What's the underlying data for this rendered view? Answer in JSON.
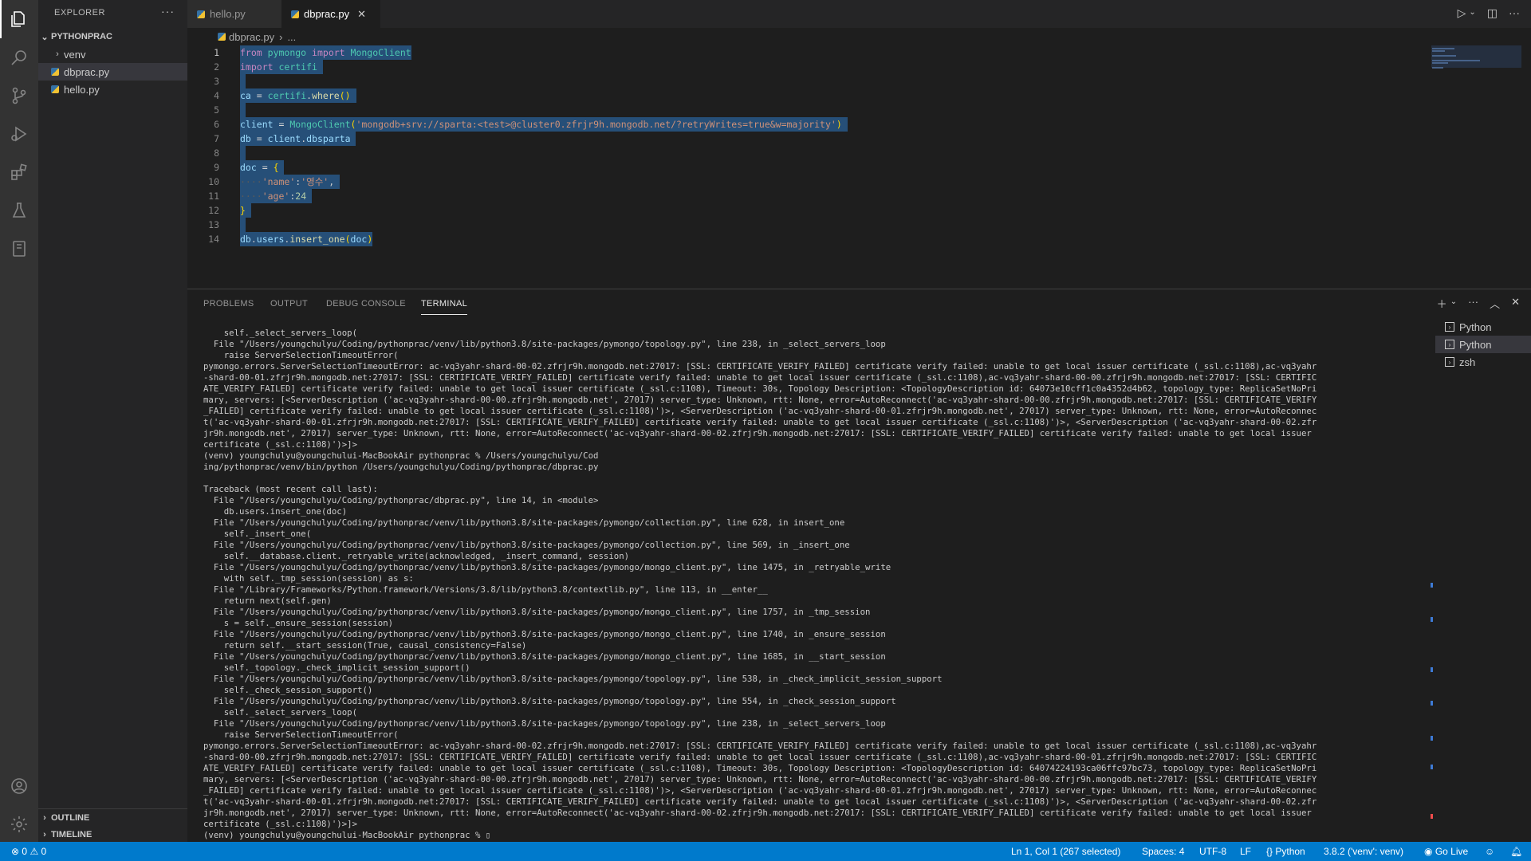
{
  "sidebar": {
    "title": "EXPLORER",
    "more": "···",
    "folder": "PYTHONPRAC",
    "items": [
      {
        "label": "venv",
        "type": "folder"
      },
      {
        "label": "dbprac.py",
        "type": "file",
        "selected": true
      },
      {
        "label": "hello.py",
        "type": "file"
      }
    ],
    "outline": "OUTLINE",
    "timeline": "TIMELINE"
  },
  "tabs": [
    {
      "label": "hello.py",
      "active": false
    },
    {
      "label": "dbprac.py",
      "active": true
    }
  ],
  "breadcrumb": {
    "file": "dbprac.py",
    "rest": "..."
  },
  "editor": {
    "line_numbers": [
      "1",
      "2",
      "3",
      "4",
      "5",
      "6",
      "7",
      "8",
      "9",
      "10",
      "11",
      "12",
      "13",
      "14"
    ]
  },
  "panel": {
    "tabs": [
      "PROBLEMS",
      "OUTPUT",
      "DEBUG CONSOLE",
      "TERMINAL"
    ],
    "active_tab": "TERMINAL",
    "terminal_list": [
      "Python",
      "Python",
      "zsh"
    ],
    "terminal_lines": [
      "    self._select_servers_loop(",
      "  File \"/Users/youngchulyu/Coding/pythonprac/venv/lib/python3.8/site-packages/pymongo/topology.py\", line 238, in _select_servers_loop",
      "    raise ServerSelectionTimeoutError(",
      "pymongo.errors.ServerSelectionTimeoutError: ac-vq3yahr-shard-00-02.zfrjr9h.mongodb.net:27017: [SSL: CERTIFICATE_VERIFY_FAILED] certificate verify failed: unable to get local issuer certificate (_ssl.c:1108),ac-vq3yahr",
      "-shard-00-01.zfrjr9h.mongodb.net:27017: [SSL: CERTIFICATE_VERIFY_FAILED] certificate verify failed: unable to get local issuer certificate (_ssl.c:1108),ac-vq3yahr-shard-00-00.zfrjr9h.mongodb.net:27017: [SSL: CERTIFIC",
      "ATE_VERIFY_FAILED] certificate verify failed: unable to get local issuer certificate (_ssl.c:1108), Timeout: 30s, Topology Description: <TopologyDescription id: 64073e10cff1c0a4352d4b62, topology_type: ReplicaSetNoPri",
      "mary, servers: [<ServerDescription ('ac-vq3yahr-shard-00-00.zfrjr9h.mongodb.net', 27017) server_type: Unknown, rtt: None, error=AutoReconnect('ac-vq3yahr-shard-00-00.zfrjr9h.mongodb.net:27017: [SSL: CERTIFICATE_VERIFY",
      "_FAILED] certificate verify failed: unable to get local issuer certificate (_ssl.c:1108)')>, <ServerDescription ('ac-vq3yahr-shard-00-01.zfrjr9h.mongodb.net', 27017) server_type: Unknown, rtt: None, error=AutoReconnec",
      "t('ac-vq3yahr-shard-00-01.zfrjr9h.mongodb.net:27017: [SSL: CERTIFICATE_VERIFY_FAILED] certificate verify failed: unable to get local issuer certificate (_ssl.c:1108)')>, <ServerDescription ('ac-vq3yahr-shard-00-02.zfr",
      "jr9h.mongodb.net', 27017) server_type: Unknown, rtt: None, error=AutoReconnect('ac-vq3yahr-shard-00-02.zfrjr9h.mongodb.net:27017: [SSL: CERTIFICATE_VERIFY_FAILED] certificate verify failed: unable to get local issuer",
      "certificate (_ssl.c:1108)')>]>",
      "(venv) youngchulyu@youngchului-MacBookAir pythonprac % /Users/youngchulyu/Cod",
      "ing/pythonprac/venv/bin/python /Users/youngchulyu/Coding/pythonprac/dbprac.py",
      "",
      "Traceback (most recent call last):",
      "  File \"/Users/youngchulyu/Coding/pythonprac/dbprac.py\", line 14, in <module>",
      "    db.users.insert_one(doc)",
      "  File \"/Users/youngchulyu/Coding/pythonprac/venv/lib/python3.8/site-packages/pymongo/collection.py\", line 628, in insert_one",
      "    self._insert_one(",
      "  File \"/Users/youngchulyu/Coding/pythonprac/venv/lib/python3.8/site-packages/pymongo/collection.py\", line 569, in _insert_one",
      "    self.__database.client._retryable_write(acknowledged, _insert_command, session)",
      "  File \"/Users/youngchulyu/Coding/pythonprac/venv/lib/python3.8/site-packages/pymongo/mongo_client.py\", line 1475, in _retryable_write",
      "    with self._tmp_session(session) as s:",
      "  File \"/Library/Frameworks/Python.framework/Versions/3.8/lib/python3.8/contextlib.py\", line 113, in __enter__",
      "    return next(self.gen)",
      "  File \"/Users/youngchulyu/Coding/pythonprac/venv/lib/python3.8/site-packages/pymongo/mongo_client.py\", line 1757, in _tmp_session",
      "    s = self._ensure_session(session)",
      "  File \"/Users/youngchulyu/Coding/pythonprac/venv/lib/python3.8/site-packages/pymongo/mongo_client.py\", line 1740, in _ensure_session",
      "    return self.__start_session(True, causal_consistency=False)",
      "  File \"/Users/youngchulyu/Coding/pythonprac/venv/lib/python3.8/site-packages/pymongo/mongo_client.py\", line 1685, in __start_session",
      "    self._topology._check_implicit_session_support()",
      "  File \"/Users/youngchulyu/Coding/pythonprac/venv/lib/python3.8/site-packages/pymongo/topology.py\", line 538, in _check_implicit_session_support",
      "    self._check_session_support()",
      "  File \"/Users/youngchulyu/Coding/pythonprac/venv/lib/python3.8/site-packages/pymongo/topology.py\", line 554, in _check_session_support",
      "    self._select_servers_loop(",
      "  File \"/Users/youngchulyu/Coding/pythonprac/venv/lib/python3.8/site-packages/pymongo/topology.py\", line 238, in _select_servers_loop",
      "    raise ServerSelectionTimeoutError(",
      "pymongo.errors.ServerSelectionTimeoutError: ac-vq3yahr-shard-00-02.zfrjr9h.mongodb.net:27017: [SSL: CERTIFICATE_VERIFY_FAILED] certificate verify failed: unable to get local issuer certificate (_ssl.c:1108),ac-vq3yahr",
      "-shard-00-00.zfrjr9h.mongodb.net:27017: [SSL: CERTIFICATE_VERIFY_FAILED] certificate verify failed: unable to get local issuer certificate (_ssl.c:1108),ac-vq3yahr-shard-00-01.zfrjr9h.mongodb.net:27017: [SSL: CERTIFIC",
      "ATE_VERIFY_FAILED] certificate verify failed: unable to get local issuer certificate (_ssl.c:1108), Timeout: 30s, Topology Description: <TopologyDescription id: 64074224193ca06ffc97bc73, topology_type: ReplicaSetNoPri",
      "mary, servers: [<ServerDescription ('ac-vq3yahr-shard-00-00.zfrjr9h.mongodb.net', 27017) server_type: Unknown, rtt: None, error=AutoReconnect('ac-vq3yahr-shard-00-00.zfrjr9h.mongodb.net:27017: [SSL: CERTIFICATE_VERIFY",
      "_FAILED] certificate verify failed: unable to get local issuer certificate (_ssl.c:1108)')>, <ServerDescription ('ac-vq3yahr-shard-00-01.zfrjr9h.mongodb.net', 27017) server_type: Unknown, rtt: None, error=AutoReconnec",
      "t('ac-vq3yahr-shard-00-01.zfrjr9h.mongodb.net:27017: [SSL: CERTIFICATE_VERIFY_FAILED] certificate verify failed: unable to get local issuer certificate (_ssl.c:1108)')>, <ServerDescription ('ac-vq3yahr-shard-00-02.zfr",
      "jr9h.mongodb.net', 27017) server_type: Unknown, rtt: None, error=AutoReconnect('ac-vq3yahr-shard-00-02.zfrjr9h.mongodb.net:27017: [SSL: CERTIFICATE_VERIFY_FAILED] certificate verify failed: unable to get local issuer",
      "certificate (_ssl.c:1108)')>]>",
      "(venv) youngchulyu@youngchului-MacBookAir pythonprac % ▯"
    ]
  },
  "statusbar": {
    "errors": "0",
    "warnings": "0",
    "cursor": "Ln 1, Col 1 (267 selected)",
    "spaces": "Spaces: 4",
    "encoding": "UTF-8",
    "eol": "LF",
    "language": "Python",
    "interpreter": "3.8.2 ('venv': venv)",
    "golive": "Go Live"
  },
  "colors": {
    "statusbar": "#007acc",
    "selection": "#264f78",
    "keyword": "#c586c0",
    "string": "#ce9178"
  }
}
